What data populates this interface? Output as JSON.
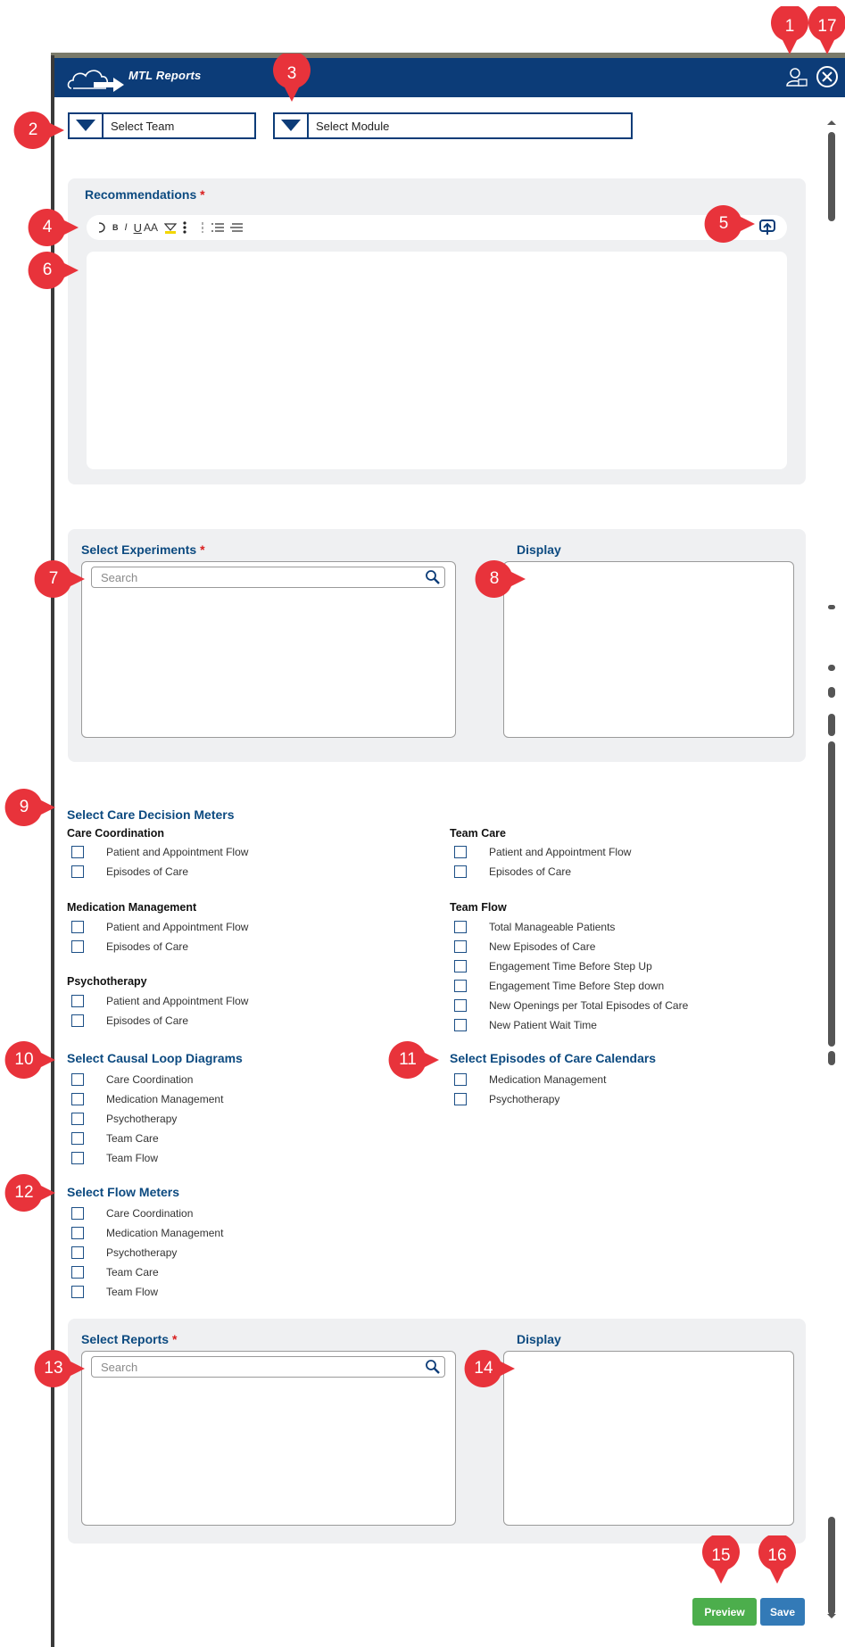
{
  "app": {
    "title": "MTL Reports"
  },
  "dropdowns": {
    "team": "Select Team",
    "module": "Select Module"
  },
  "recommendations": {
    "title": "Recommendations",
    "required": "*"
  },
  "editor_toolbar": {
    "undo": "undo-icon",
    "bold": "B",
    "italic": "I",
    "underline": "U",
    "font_size": "AA",
    "highlight": "highlight-icon",
    "more": "more-icon",
    "list1": "list-icon",
    "list2": "list-icon",
    "list3": "list-icon",
    "upload": "upload-icon"
  },
  "experiments": {
    "title": "Select Experiments",
    "required": "*",
    "search_placeholder": "Search",
    "display_title": "Display"
  },
  "care_decision_meters": {
    "title": "Select Care Decision Meters",
    "groups": [
      {
        "name": "Care Coordination",
        "items": [
          "Patient and Appointment Flow",
          "Episodes of Care"
        ]
      },
      {
        "name": "Team Care",
        "items": [
          "Patient and Appointment Flow",
          "Episodes of Care"
        ]
      },
      {
        "name": "Medication Management",
        "items": [
          "Patient and Appointment Flow",
          "Episodes of Care"
        ]
      },
      {
        "name": "Team Flow",
        "items": [
          "Total Manageable Patients",
          "New Episodes of Care",
          "Engagement Time Before Step Up",
          "Engagement Time Before Step down",
          "New Openings per Total Episodes of Care",
          "New Patient Wait Time"
        ]
      },
      {
        "name": "Psychotherapy",
        "items": [
          "Patient and Appointment Flow",
          "Episodes of Care"
        ]
      }
    ]
  },
  "causal_loop": {
    "title": "Select Causal Loop Diagrams",
    "items": [
      "Care Coordination",
      "Medication Management",
      "Psychotherapy",
      "Team Care",
      "Team Flow"
    ]
  },
  "episodes_calendars": {
    "title": "Select Episodes of Care Calendars",
    "items": [
      "Medication Management",
      "Psychotherapy"
    ]
  },
  "flow_meters": {
    "title": "Select Flow Meters",
    "items": [
      "Care Coordination",
      "Medication Management",
      "Psychotherapy",
      "Team Care",
      "Team Flow"
    ]
  },
  "reports": {
    "title": "Select Reports",
    "required": "*",
    "search_placeholder": "Search",
    "display_title": "Display"
  },
  "buttons": {
    "preview": "Preview",
    "save": "Save",
    "preview_color": "#4cae4c",
    "save_color": "#337ab7"
  },
  "markers": [
    "1",
    "2",
    "3",
    "4",
    "5",
    "6",
    "7",
    "8",
    "9",
    "10",
    "11",
    "12",
    "13",
    "14",
    "15",
    "16",
    "17"
  ],
  "colors": {
    "brand": "#0c3c78",
    "marker": "#e8333b",
    "heading": "#0c4a80",
    "required": "#d91e1e"
  }
}
